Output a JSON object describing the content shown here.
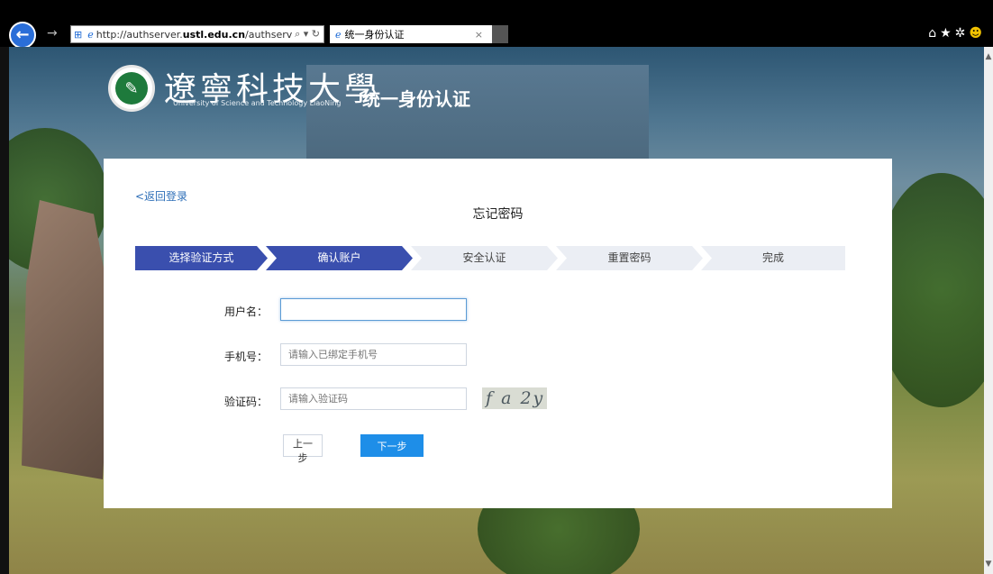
{
  "browser": {
    "url_prefix": "http://authserver.",
    "url_domain": "ustl.edu.cn",
    "url_suffix": "/authserv",
    "tab_title": "统一身份认证",
    "tab_close": "×"
  },
  "header": {
    "logo_cn": "遼寧科技大學",
    "logo_en": "University of Science and Technology LiaoNing",
    "system_title": "统一身份认证"
  },
  "card": {
    "back_link": "<返回登录",
    "title": "忘记密码",
    "steps": [
      {
        "label": "选择验证方式",
        "active": true
      },
      {
        "label": "确认账户",
        "active": true
      },
      {
        "label": "安全认证",
        "active": false
      },
      {
        "label": "重置密码",
        "active": false
      },
      {
        "label": "完成",
        "active": false
      }
    ],
    "form": {
      "username_label": "用户名：",
      "username_value": "",
      "phone_label": "手机号：",
      "phone_placeholder": "请输入已绑定手机号",
      "captcha_label": "验证码：",
      "captcha_placeholder": "请输入验证码",
      "captcha_text": "f a 2y"
    },
    "buttons": {
      "prev": "上一步",
      "next": "下一步"
    }
  },
  "colors": {
    "step_active": "#3a4fae",
    "step_inactive": "#ebeef4",
    "primary_button": "#1e8ee8",
    "link": "#2e6fb8"
  }
}
